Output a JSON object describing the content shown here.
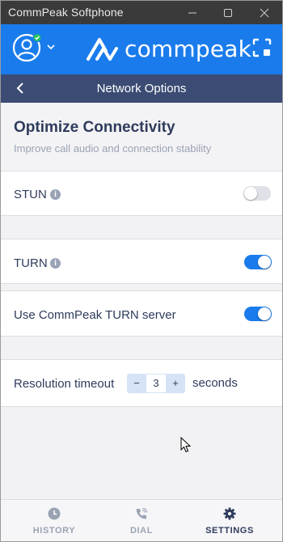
{
  "window": {
    "title": "CommPeak Softphone"
  },
  "brand": {
    "name": "commpeak",
    "color": "#1a7cec"
  },
  "header": {
    "title": "Network Options"
  },
  "section": {
    "title": "Optimize Connectivity",
    "subtitle": "Improve call audio and connection stability"
  },
  "settings": {
    "stun": {
      "label": "STUN",
      "enabled": false
    },
    "turn": {
      "label": "TURN",
      "enabled": true
    },
    "commpeak_turn": {
      "label": "Use CommPeak TURN server",
      "enabled": true
    },
    "timeout": {
      "label": "Resolution timeout",
      "value": "3",
      "minus": "−",
      "plus": "+",
      "unit": "seconds"
    }
  },
  "nav": [
    {
      "label": "HISTORY",
      "icon": "clock-icon",
      "active": false
    },
    {
      "label": "DIAL",
      "icon": "phone-icon",
      "active": false
    },
    {
      "label": "SETTINGS",
      "icon": "gear-icon",
      "active": true
    }
  ],
  "colors": {
    "dark_navy": "#3b4b74",
    "text": "#2f3b5c",
    "muted": "#9aa3b3",
    "titlebar": "#3a3a3a",
    "status_online": "#22c55e"
  }
}
